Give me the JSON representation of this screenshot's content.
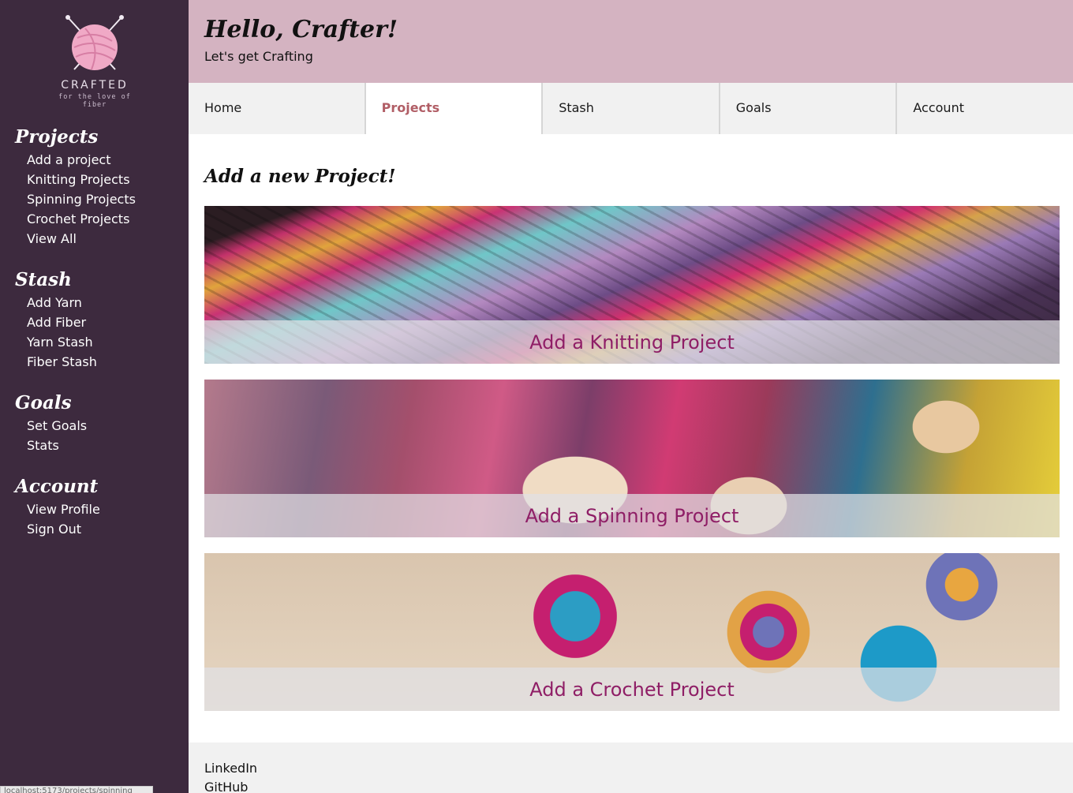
{
  "logo": {
    "name": "CRAFTED",
    "tagline": "for the love of fiber"
  },
  "sidebar": {
    "sections": [
      {
        "heading": "Projects",
        "items": [
          "Add a project",
          "Knitting Projects",
          "Spinning Projects",
          "Crochet Projects",
          "View All"
        ]
      },
      {
        "heading": "Stash",
        "items": [
          "Add Yarn",
          "Add Fiber",
          "Yarn Stash",
          "Fiber Stash"
        ]
      },
      {
        "heading": "Goals",
        "items": [
          "Set Goals",
          "Stats"
        ]
      },
      {
        "heading": "Account",
        "items": [
          "View Profile",
          "Sign Out"
        ]
      }
    ]
  },
  "header": {
    "greeting": "Hello, Crafter!",
    "subtitle": "Let's get Crafting"
  },
  "tabs": [
    {
      "label": "Home",
      "active": false
    },
    {
      "label": "Projects",
      "active": true
    },
    {
      "label": "Stash",
      "active": false
    },
    {
      "label": "Goals",
      "active": false
    },
    {
      "label": "Account",
      "active": false
    }
  ],
  "main": {
    "title": "Add a new Project!",
    "cards": [
      {
        "label": "Add a Knitting Project"
      },
      {
        "label": "Add a Spinning Project"
      },
      {
        "label": "Add a Crochet Project"
      }
    ]
  },
  "footer": {
    "links": [
      "LinkedIn",
      "GitHub"
    ]
  },
  "status_url": "localhost:5173/projects/spinning",
  "colors": {
    "sidebar": "#3d2a3e",
    "header": "#d4b3c1",
    "active_tab": "#b15e66",
    "card_label": "#8f1e66"
  }
}
